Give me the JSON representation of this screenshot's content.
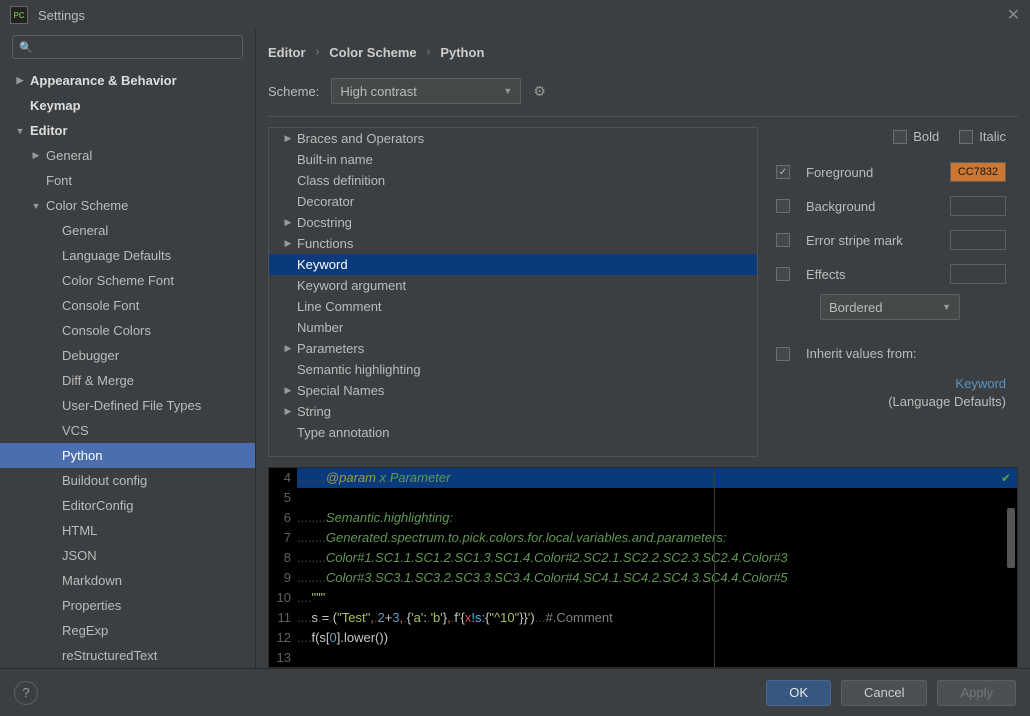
{
  "title": "Settings",
  "breadcrumb": [
    "Editor",
    "Color Scheme",
    "Python"
  ],
  "scheme": {
    "label": "Scheme:",
    "value": "High contrast"
  },
  "search": {
    "placeholder": ""
  },
  "sidebar": [
    {
      "label": "Appearance & Behavior",
      "depth": 0,
      "bold": true,
      "arrow": "▶"
    },
    {
      "label": "Keymap",
      "depth": 0,
      "bold": true
    },
    {
      "label": "Editor",
      "depth": 0,
      "bold": true,
      "arrow": "▼"
    },
    {
      "label": "General",
      "depth": 1,
      "arrow": "▶"
    },
    {
      "label": "Font",
      "depth": 1
    },
    {
      "label": "Color Scheme",
      "depth": 1,
      "arrow": "▼"
    },
    {
      "label": "General",
      "depth": 2
    },
    {
      "label": "Language Defaults",
      "depth": 2
    },
    {
      "label": "Color Scheme Font",
      "depth": 2
    },
    {
      "label": "Console Font",
      "depth": 2
    },
    {
      "label": "Console Colors",
      "depth": 2
    },
    {
      "label": "Debugger",
      "depth": 2
    },
    {
      "label": "Diff & Merge",
      "depth": 2
    },
    {
      "label": "User-Defined File Types",
      "depth": 2
    },
    {
      "label": "VCS",
      "depth": 2
    },
    {
      "label": "Python",
      "depth": 2,
      "selected": true
    },
    {
      "label": "Buildout config",
      "depth": 2
    },
    {
      "label": "EditorConfig",
      "depth": 2
    },
    {
      "label": "HTML",
      "depth": 2
    },
    {
      "label": "JSON",
      "depth": 2
    },
    {
      "label": "Markdown",
      "depth": 2
    },
    {
      "label": "Properties",
      "depth": 2
    },
    {
      "label": "RegExp",
      "depth": 2
    },
    {
      "label": "reStructuredText",
      "depth": 2
    }
  ],
  "attrs": [
    {
      "label": "Braces and Operators",
      "arrow": "▶"
    },
    {
      "label": "Built-in name"
    },
    {
      "label": "Class definition"
    },
    {
      "label": "Decorator"
    },
    {
      "label": "Docstring",
      "arrow": "▶"
    },
    {
      "label": "Functions",
      "arrow": "▶"
    },
    {
      "label": "Keyword",
      "selected": true
    },
    {
      "label": "Keyword argument"
    },
    {
      "label": "Line Comment"
    },
    {
      "label": "Number"
    },
    {
      "label": "Parameters",
      "arrow": "▶"
    },
    {
      "label": "Semantic highlighting"
    },
    {
      "label": "Special Names",
      "arrow": "▶"
    },
    {
      "label": "String",
      "arrow": "▶"
    },
    {
      "label": "Type annotation"
    }
  ],
  "props": {
    "bold": "Bold",
    "italic": "Italic",
    "foreground": {
      "label": "Foreground",
      "checked": true,
      "value": "CC7832"
    },
    "background": {
      "label": "Background",
      "checked": false
    },
    "errorstripe": {
      "label": "Error stripe mark",
      "checked": false
    },
    "effects": {
      "label": "Effects",
      "checked": false,
      "type": "Bordered"
    },
    "inherit": {
      "label": "Inherit values from:",
      "checked": false,
      "link": "Keyword",
      "source": "(Language Defaults)"
    }
  },
  "preview": {
    "start": 4,
    "lines": [
      {
        "n": 4,
        "hl": true,
        "segs": [
          {
            "t": "........",
            "c": "c-dot"
          },
          {
            "t": "@param",
            "c": "c-tag"
          },
          {
            "t": ".",
            "c": "c-dot"
          },
          {
            "t": "x",
            "c": "c-ital"
          },
          {
            "t": ".",
            "c": "c-dot"
          },
          {
            "t": "Parameter",
            "c": "c-ital"
          }
        ]
      },
      {
        "n": 5,
        "segs": []
      },
      {
        "n": 6,
        "segs": [
          {
            "t": "........",
            "c": "c-dot"
          },
          {
            "t": "Semantic.highlighting:",
            "c": "c-ital"
          }
        ]
      },
      {
        "n": 7,
        "segs": [
          {
            "t": "........",
            "c": "c-dot"
          },
          {
            "t": "Generated.spectrum.to.pick.colors.for.local.variables.and.parameters:",
            "c": "c-ital"
          }
        ]
      },
      {
        "n": 8,
        "segs": [
          {
            "t": "........",
            "c": "c-dot"
          },
          {
            "t": "Color#1.SC1.1.SC1.2.SC1.3.SC1.4.Color#2.SC2.1.SC2.2.SC2.3.SC2.4.Color#3",
            "c": "c-ital"
          }
        ]
      },
      {
        "n": 9,
        "segs": [
          {
            "t": "........",
            "c": "c-dot"
          },
          {
            "t": "Color#3.SC3.1.SC3.2.SC3.3.SC3.4.Color#4.SC4.1.SC4.2.SC4.3.SC4.4.Color#5",
            "c": "c-ital"
          }
        ]
      },
      {
        "n": 10,
        "segs": [
          {
            "t": "....",
            "c": "c-dot"
          },
          {
            "t": "\"\"\"",
            "c": "c-str"
          }
        ]
      },
      {
        "n": 11,
        "segs": [
          {
            "t": "....",
            "c": "c-dot"
          },
          {
            "t": "s",
            "c": "c-white"
          },
          {
            "t": ".",
            "c": "c-dot"
          },
          {
            "t": "=",
            "c": "c-white"
          },
          {
            "t": ".",
            "c": "c-dot"
          },
          {
            "t": "(",
            "c": "c-white"
          },
          {
            "t": "\"Test\"",
            "c": "c-str"
          },
          {
            "t": ",",
            "c": "c-orange"
          },
          {
            "t": ".",
            "c": "c-dot"
          },
          {
            "t": "2",
            "c": "c-num"
          },
          {
            "t": "+",
            "c": "c-white"
          },
          {
            "t": "3",
            "c": "c-num"
          },
          {
            "t": ",",
            "c": "c-orange"
          },
          {
            "t": ".",
            "c": "c-dot"
          },
          {
            "t": "{",
            "c": "c-white"
          },
          {
            "t": "'a'",
            "c": "c-str"
          },
          {
            "t": ":",
            "c": "c-white"
          },
          {
            "t": ".",
            "c": "c-dot"
          },
          {
            "t": "'b'",
            "c": "c-str"
          },
          {
            "t": "}",
            "c": "c-white"
          },
          {
            "t": ",",
            "c": "c-orange"
          },
          {
            "t": ".",
            "c": "c-dot"
          },
          {
            "t": "f",
            "c": "c-white"
          },
          {
            "t": "'",
            "c": "c-str"
          },
          {
            "t": "{",
            "c": "c-white"
          },
          {
            "t": "x",
            "c": "c-red"
          },
          {
            "t": "!s:",
            "c": "c-cyan"
          },
          {
            "t": "{",
            "c": "c-white"
          },
          {
            "t": "\"^10\"",
            "c": "c-str"
          },
          {
            "t": "}",
            "c": "c-white"
          },
          {
            "t": "}",
            "c": "c-white"
          },
          {
            "t": "'",
            "c": "c-str"
          },
          {
            "t": ")",
            "c": "c-white"
          },
          {
            "t": "...",
            "c": "c-dot"
          },
          {
            "t": "#.Comment",
            "c": "c-comment"
          }
        ]
      },
      {
        "n": 12,
        "segs": [
          {
            "t": "....",
            "c": "c-dot"
          },
          {
            "t": "f(s[",
            "c": "c-white"
          },
          {
            "t": "0",
            "c": "c-num"
          },
          {
            "t": "].lower())",
            "c": "c-white"
          }
        ]
      },
      {
        "n": 13,
        "segs": []
      }
    ]
  },
  "buttons": {
    "ok": "OK",
    "cancel": "Cancel",
    "apply": "Apply"
  }
}
